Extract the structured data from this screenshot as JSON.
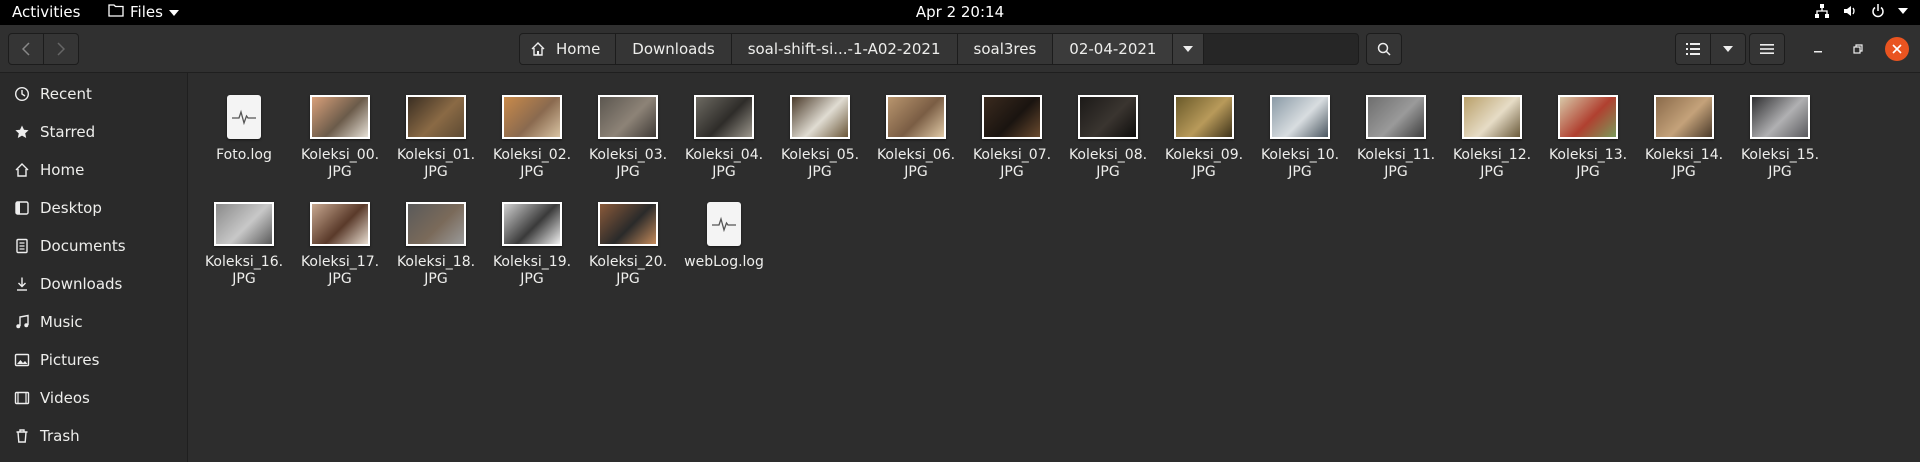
{
  "topbar": {
    "activities": "Activities",
    "app_name": "Files",
    "clock": "Apr 2  20:14"
  },
  "pathbar": {
    "crumbs": [
      "Home",
      "Downloads",
      "soal-shift-si...-1-A02-2021",
      "soal3res",
      "02-04-2021"
    ]
  },
  "sidebar": {
    "items": [
      {
        "label": "Recent",
        "icon": "clock-icon"
      },
      {
        "label": "Starred",
        "icon": "star-icon"
      },
      {
        "label": "Home",
        "icon": "home-icon"
      },
      {
        "label": "Desktop",
        "icon": "desktop-icon"
      },
      {
        "label": "Documents",
        "icon": "document-icon"
      },
      {
        "label": "Downloads",
        "icon": "download-icon"
      },
      {
        "label": "Music",
        "icon": "music-icon"
      },
      {
        "label": "Pictures",
        "icon": "picture-icon"
      },
      {
        "label": "Videos",
        "icon": "video-icon"
      },
      {
        "label": "Trash",
        "icon": "trash-icon"
      }
    ]
  },
  "files": [
    {
      "name": "Foto.log",
      "kind": "log"
    },
    {
      "name": "Koleksi_00.\nJPG",
      "kind": "image",
      "colors": [
        "#d9a07a",
        "#6b5b4a",
        "#e6e0d6"
      ]
    },
    {
      "name": "Koleksi_01.\nJPG",
      "kind": "image",
      "colors": [
        "#3a2e22",
        "#8a6a45",
        "#5d4a33"
      ]
    },
    {
      "name": "Koleksi_02.\nJPG",
      "kind": "image",
      "colors": [
        "#c98a4a",
        "#8a6a4f",
        "#d8c2a2"
      ]
    },
    {
      "name": "Koleksi_03.\nJPG",
      "kind": "image",
      "colors": [
        "#5c5750",
        "#8d8377",
        "#3f3a36"
      ]
    },
    {
      "name": "Koleksi_04.\nJPG",
      "kind": "image",
      "colors": [
        "#6d6a62",
        "#2e2c29",
        "#9c978d"
      ]
    },
    {
      "name": "Koleksi_05.\nJPG",
      "kind": "image",
      "colors": [
        "#4a3a2a",
        "#e0dcd2",
        "#6a5638"
      ]
    },
    {
      "name": "Koleksi_06.\nJPG",
      "kind": "image",
      "colors": [
        "#b8956e",
        "#7a5d44",
        "#e0c9a6"
      ]
    },
    {
      "name": "Koleksi_07.\nJPG",
      "kind": "image",
      "colors": [
        "#3a2a1e",
        "#1a1410",
        "#6a4a2e"
      ]
    },
    {
      "name": "Koleksi_08.\nJPG",
      "kind": "image",
      "colors": [
        "#1c1a18",
        "#3a3530",
        "#0e0d0c"
      ]
    },
    {
      "name": "Koleksi_09.\nJPG",
      "kind": "image",
      "colors": [
        "#6a5a2a",
        "#b89a5a",
        "#3e331a"
      ]
    },
    {
      "name": "Koleksi_10.\nJPG",
      "kind": "image",
      "colors": [
        "#8a9aa6",
        "#d8dde0",
        "#4a5660"
      ]
    },
    {
      "name": "Koleksi_11.\nJPG",
      "kind": "image",
      "colors": [
        "#6e6e6e",
        "#9a9a9a",
        "#3e3e3e"
      ]
    },
    {
      "name": "Koleksi_12.\nJPG",
      "kind": "image",
      "colors": [
        "#b9a06a",
        "#e6dcc6",
        "#6a5a3a"
      ]
    },
    {
      "name": "Koleksi_13.\nJPG",
      "kind": "image",
      "colors": [
        "#d8c8a8",
        "#b04030",
        "#7a9a5a"
      ]
    },
    {
      "name": "Koleksi_14.\nJPG",
      "kind": "image",
      "colors": [
        "#8a6a4a",
        "#c4a27a",
        "#4a3a2a"
      ]
    },
    {
      "name": "Koleksi_15.\nJPG",
      "kind": "image",
      "colors": [
        "#2e2e30",
        "#b0b0b2",
        "#5a5a5e"
      ]
    },
    {
      "name": "Koleksi_16.\nJPG",
      "kind": "image",
      "colors": [
        "#8a8a8a",
        "#c8c8c8",
        "#5a5a5a"
      ]
    },
    {
      "name": "Koleksi_17.\nJPG",
      "kind": "image",
      "colors": [
        "#c8a890",
        "#5a3a2a",
        "#e8ddd0"
      ]
    },
    {
      "name": "Koleksi_18.\nJPG",
      "kind": "image",
      "colors": [
        "#5a5a5a",
        "#7a6a5a",
        "#9a9a9a"
      ]
    },
    {
      "name": "Koleksi_19.\nJPG",
      "kind": "image",
      "colors": [
        "#d0d0d0",
        "#3a3a3a",
        "#f0f0f0"
      ]
    },
    {
      "name": "Koleksi_20.\nJPG",
      "kind": "image",
      "colors": [
        "#8a5a3a",
        "#2a2a2a",
        "#c48a5a"
      ]
    },
    {
      "name": "webLog.log",
      "kind": "log"
    }
  ]
}
